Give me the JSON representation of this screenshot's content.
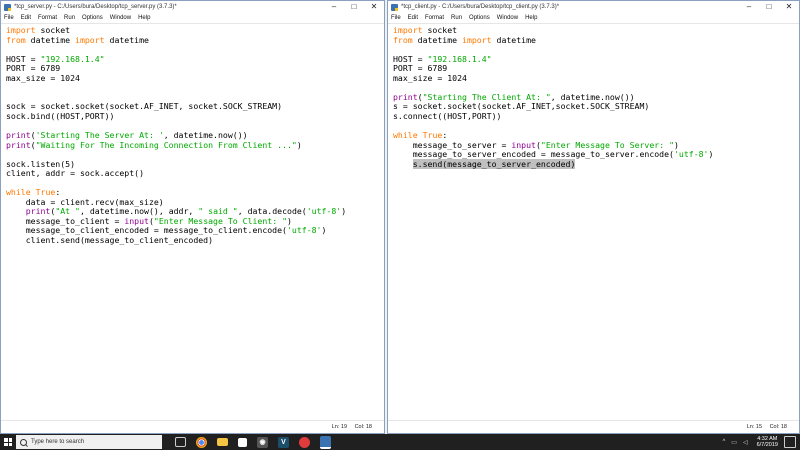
{
  "left_window": {
    "title": "*tcp_server.py - C:/Users/bura/Desktop/tcp_server.py (3.7.3)*",
    "menu": [
      "File",
      "Edit",
      "Format",
      "Run",
      "Options",
      "Window",
      "Help"
    ],
    "status": {
      "line": "Ln: 19",
      "col": "Col: 18"
    }
  },
  "right_window": {
    "title": "*tcp_client.py - C:/Users/bura/Desktop/tcp_client.py (3.7.3)*",
    "menu": [
      "File",
      "Edit",
      "Format",
      "Run",
      "Options",
      "Window",
      "Help"
    ],
    "status": {
      "line": "Ln: 15",
      "col": "Col: 18"
    }
  },
  "server_code": [
    "import socket",
    "from datetime import datetime",
    "",
    "HOST = \"192.168.1.4\"",
    "PORT = 6789",
    "max_size = 1024",
    "",
    "",
    "sock = socket.socket(socket.AF_INET, socket.SOCK_STREAM)",
    "sock.bind((HOST,PORT))",
    "",
    "print('Starting The Server At: ', datetime.now())",
    "print(\"Waiting For The Incoming Connection From Client ...\")",
    "",
    "sock.listen(5)",
    "client, addr = sock.accept()",
    "",
    "while True:",
    "    data = client.recv(max_size)",
    "    print(\"At \", datetime.now(), addr, \" said \", data.decode('utf-8')",
    "    message_to_client = input(\"Enter Message To Client: \")",
    "    message_to_client_encoded = message_to_client.encode('utf-8')",
    "    client.send(message_to_client_encoded)"
  ],
  "client_code": [
    "import socket",
    "from datetime import datetime",
    "",
    "HOST = \"192.168.1.4\"",
    "PORT = 6789",
    "max_size = 1024",
    "",
    "print(\"Starting The Client At: \", datetime.now())",
    "s = socket.socket(socket.AF_INET,socket.SOCK_STREAM)",
    "s.connect((HOST,PORT))",
    "",
    "while True:",
    "    message_to_server = input(\"Enter Message To Server: \")",
    "    message_to_server_encoded = message_to_server.encode('utf-8')",
    "    s.send(message_to_server_encoded)"
  ],
  "taskbar": {
    "search_placeholder": "Type here to search",
    "time": "4:32 AM",
    "date": "6/7/2019",
    "icons": [
      "task-view-icon",
      "chrome-icon",
      "file-explorer-icon",
      "store-icon",
      "camera-icon",
      "vs-icon",
      "headphones-icon",
      "python-idle-icon"
    ]
  }
}
